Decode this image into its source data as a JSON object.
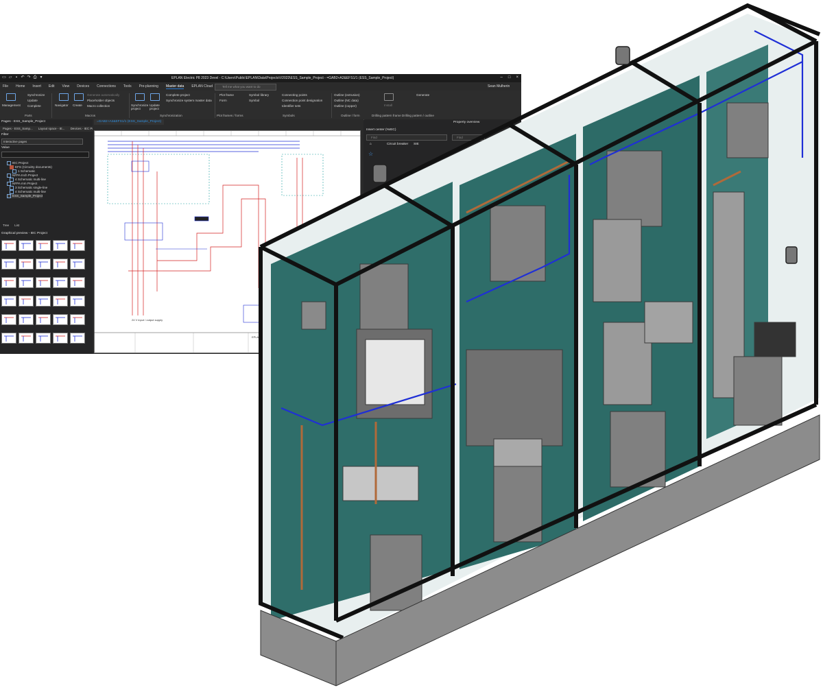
{
  "window": {
    "title": "EPLAN Electric P8 2023 Devel - C:\\Users\\Public\\EPLAN\\Data\\Projects\\V2023\\ESS_Sample_Project - =GAB2+A2&EFS1/1 (ESS_Sample_Project)"
  },
  "menu": {
    "items": [
      "File",
      "Home",
      "Insert",
      "Edit",
      "View",
      "Devices",
      "Connections",
      "Tools",
      "Pre-planning",
      "Master data",
      "EPLAN Cloud"
    ],
    "active": "Master data",
    "search_placeholder": "Tell me what you want to do",
    "user": "Sean Mulherin"
  },
  "ribbon": {
    "management": "Management",
    "synchronize": "Synchronize",
    "update": "Update",
    "complete": "Complete",
    "parts_group": "Parts",
    "navigator": "Navigator",
    "create": "Create",
    "generate_auto": "Generate automatically",
    "placeholder_objects": "Placeholder objects",
    "macro_collection": "Macro collection",
    "macros_group": "Macros",
    "synchronize_project": "Synchronize project",
    "update_project": "Update project",
    "complete_project": "Complete project",
    "sync_system_master": "Synchronize system master data",
    "synchronization_group": "Synchronization",
    "plot_frame": "Plot frame",
    "form": "Form",
    "plot_frames_group": "Plot frames / forms",
    "symbol_library": "Symbol library",
    "symbol": "Symbol",
    "connecting_points": "Connecting points",
    "connection_point_designation": "Connection point designation",
    "identifier_sets": "Identifier sets",
    "symbols_group": "Symbols",
    "outline_extrusion": "Outline (extrusion)",
    "outline_nc": "Outline (NC data)",
    "outline_copper": "Outline (copper)",
    "outline_group": "Outline / form",
    "install": "Install",
    "drilling_group": "Drilling pattern frame   Drilling pattern / outline",
    "generate": "Generate"
  },
  "left_panel": {
    "pages_title": "Pages - ESS_Sample_Project",
    "tabs": [
      "Pages - ESS_Samp...",
      "Layout space - IE...",
      "Devices - IEC Proj..."
    ],
    "filter_label": "Filter",
    "filter_value": "Interactive pages",
    "value_label": "Value",
    "tree": [
      "IEC Project",
      "EFS (Circuitry documents)",
      "1 Schematic",
      "NFPA Inch Project",
      "4 Schematic multi-line",
      "NFPA mm Project",
      "3 Schematic single-line",
      "4 Schematic multi-line",
      "ESS_Sample_Project"
    ],
    "bottom_tabs": [
      "Tree",
      "List"
    ],
    "preview_title": "Graphical preview - IEC Project"
  },
  "canvas": {
    "tab_label": "=GAB2+A2&EFS1/1 (ESS_Sample_Project)",
    "sheet_labels": [
      "24 V input / output supply",
      "EPLAN GmbH & Co. KG"
    ]
  },
  "right_panel": {
    "insert_center": "Insert center (%IEC)",
    "find_placeholder": "Find",
    "breadcrumb": "Circuit breaker",
    "breadcrumb_sub": "SIE",
    "property_overview": "Property overview",
    "property_find": "Find"
  },
  "colors": {
    "app_bg": "#252526",
    "accent": "#2b7bd3",
    "cabinet_frame": "#111111",
    "cabinet_backplate": "#2f6e6a",
    "wire_blue": "#1f2fd6",
    "wire_red": "#d42020"
  }
}
